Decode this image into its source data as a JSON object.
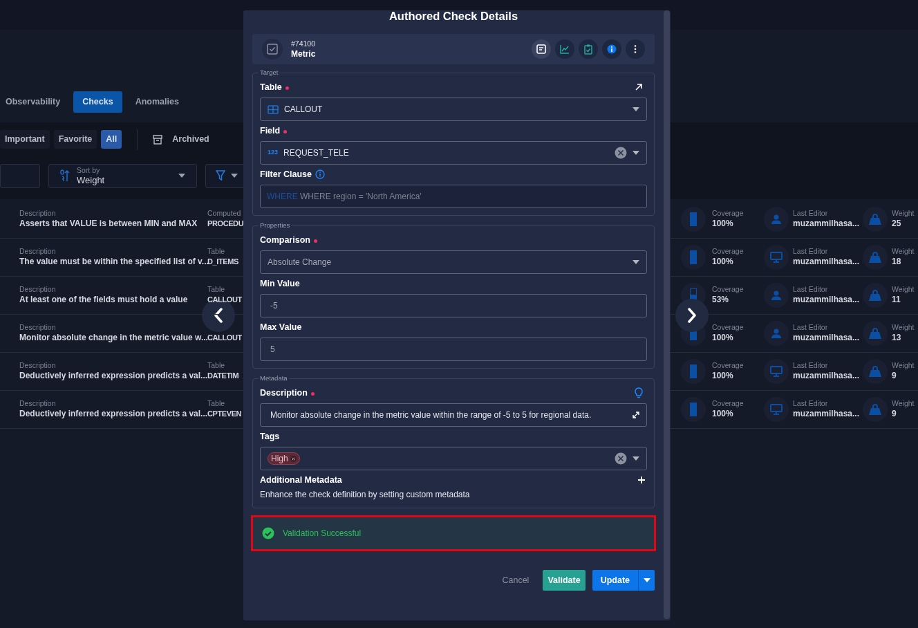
{
  "nav_tabs": [
    {
      "label": "Observability",
      "selected": false
    },
    {
      "label": "Checks",
      "selected": true
    },
    {
      "label": "Anomalies",
      "selected": false
    }
  ],
  "filter_tabs": [
    {
      "label": "Important",
      "selected": false
    },
    {
      "label": "Favorite",
      "selected": false
    },
    {
      "label": "All",
      "selected": true
    }
  ],
  "archived": {
    "label": "Archived"
  },
  "sort": {
    "caption": "Sort by",
    "value": "Weight"
  },
  "checks": [
    {
      "description_label": "Description",
      "description": "Asserts that VALUE is between MIN and MAX",
      "table_label": "Computed",
      "table": "PROCEDU",
      "coverage_label": "Coverage",
      "coverage": "100%",
      "level": 1,
      "editor_label": "Last Editor",
      "editor": "muzammilhasa...",
      "editor_icon": {
        "kind": "user"
      },
      "weight_label": "Weight",
      "weight": "25"
    },
    {
      "description_label": "Description",
      "description": "The value must be within the specified list of v...",
      "table_label": "Table",
      "table": "D_ITEMS",
      "coverage_label": "Coverage",
      "coverage": "100%",
      "level": 1,
      "editor_label": "Last Editor",
      "editor": "muzammilhasa...",
      "editor_icon": {
        "kind": "system"
      },
      "weight_label": "Weight",
      "weight": "18"
    },
    {
      "description_label": "Description",
      "description": "At least one of the fields must hold a value",
      "table_label": "Table",
      "table": "CALLOUT",
      "coverage_label": "Coverage",
      "coverage": "53%",
      "level": 0.53,
      "editor_label": "Last Editor",
      "editor": "muzammilhasa...",
      "editor_icon": {
        "kind": "user"
      },
      "weight_label": "Weight",
      "weight": "11"
    },
    {
      "description_label": "Description",
      "description": "Monitor absolute change in the metric value w...",
      "table": "CALLOUT",
      "coverage_label": "Coverage",
      "coverage": "100%",
      "level": 1,
      "editor_label": "Last Editor",
      "editor": "muzammilhasa...",
      "editor_icon": {
        "kind": "user"
      },
      "weight_label": "Weight",
      "weight": "13"
    },
    {
      "description_label": "Description",
      "description": "Deductively inferred expression predicts a val...",
      "table_label": "Table",
      "table": "DATETIM",
      "coverage_label": "Coverage",
      "coverage": "100%",
      "level": 1,
      "editor_label": "Last Editor",
      "editor": "muzammilhasa...",
      "editor_icon": {
        "kind": "system"
      },
      "weight_label": "Weight",
      "weight": "9"
    },
    {
      "description_label": "Description",
      "description": "Deductively inferred expression predicts a val...",
      "table_label": "Table",
      "table": "CPTEVEN",
      "coverage_label": "Coverage",
      "coverage": "100%",
      "level": 1,
      "editor_label": "Last Editor",
      "editor": "muzammilhasa...",
      "editor_icon": {
        "kind": "system"
      },
      "weight_label": "Weight",
      "weight": "9"
    }
  ],
  "modal": {
    "title": "Authored Check Details",
    "check_id": "#74100",
    "check_type": "Metric",
    "actions": [
      {
        "kind": "note"
      },
      {
        "kind": "chart"
      },
      {
        "kind": "clipboard"
      },
      {
        "kind": "info"
      },
      {
        "kind": "more"
      }
    ],
    "sections": [
      {
        "legend": "Target",
        "fields": [
          {
            "kind": "table_select",
            "label": "Table",
            "required": true,
            "label_action": {
              "kind": "arrow"
            },
            "value": "CALLOUT",
            "clearable": false
          },
          {
            "kind": "select",
            "label": "Field",
            "required": true,
            "type_badge": "123",
            "value": "REQUEST_TELE",
            "clearable": true
          },
          {
            "kind": "filter",
            "label": "Filter Clause",
            "required": false,
            "label_action": {
              "kind": "info"
            },
            "prefix": "WHERE",
            "placeholder": "WHERE region = 'North America'"
          }
        ]
      },
      {
        "legend": "Properties",
        "fields": [
          {
            "kind": "select",
            "label": "Comparison",
            "required": true,
            "value": "Absolute Change",
            "clearable": false
          },
          {
            "kind": "input",
            "label": "Min Value",
            "required": false,
            "value": "-5"
          },
          {
            "kind": "input",
            "label": "Max Value",
            "required": false,
            "value": "5"
          }
        ]
      },
      {
        "legend": "Metadata",
        "fields": [
          {
            "kind": "text",
            "label": "Description",
            "required": true,
            "label_action": {
              "kind": "bulb"
            },
            "value": "Monitor absolute change in the metric value within the range of -5 to 5 for regional data."
          },
          {
            "kind": "tags",
            "label": "Tags",
            "required": false,
            "tags": [
              "High"
            ],
            "clearable": true
          },
          {
            "kind": "extra",
            "label": "Additional Metadata",
            "text": "Enhance the check definition by setting custom metadata"
          }
        ]
      }
    ],
    "validation": {
      "kind": "success",
      "message": "Validation Successful"
    },
    "buttons": [
      {
        "kind": "cancel",
        "label": "Cancel"
      },
      {
        "kind": "validate",
        "label": "Validate"
      },
      {
        "kind": "split",
        "label": "Update"
      }
    ]
  }
}
